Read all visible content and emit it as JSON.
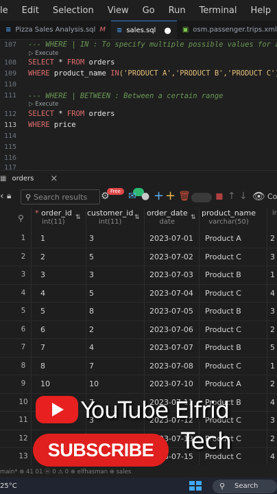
{
  "menubar": {
    "items": [
      "le",
      "Edit",
      "Selection",
      "View",
      "Go",
      "Run",
      "Terminal",
      "Help"
    ]
  },
  "tabs": [
    {
      "label": "Pizza Sales Analysis.sql",
      "modified": "M",
      "icon": "database-icon"
    },
    {
      "label": "sales.sql",
      "unsaved_dot": "●",
      "icon": "database-icon"
    },
    {
      "label": "osm.passenger.trips.xml",
      "icon": "xml-file-icon"
    }
  ],
  "editor": {
    "lines": [
      {
        "num": "107",
        "text": "--- WHERE | IN : To specify multiple possible values for a"
      },
      {
        "lens": "Execute"
      },
      {
        "num": "108",
        "kw1": "SELECT",
        "rest1": " * ",
        "kw2": "FROM",
        "rest2": " orders"
      },
      {
        "num": "109",
        "kw1": "WHERE",
        "rest1": " product_name ",
        "kw2": "IN",
        "str": "('PRODUCT A','PRODUCT B','PRODUCT C');"
      },
      {
        "num": "110"
      },
      {
        "num": "111"
      },
      {
        "num": "111",
        "text": "--- WHERE | BETWEEN : Between a certain range"
      },
      {
        "lens": "Execute"
      },
      {
        "num": "112",
        "kw1": "SELECT",
        "rest1": " * ",
        "kw2": "FROM",
        "rest2": " orders"
      },
      {
        "num": "113",
        "kw1": "WHERE",
        "rest1": " price"
      },
      {
        "num": "114"
      },
      {
        "num": "115"
      },
      {
        "num": "116"
      },
      {
        "num": "117"
      }
    ]
  },
  "panel": {
    "tab_label": "orders",
    "close": "×"
  },
  "toolbar": {
    "search_placeholder": "Search results",
    "badge": "Free",
    "co_label": "Co"
  },
  "grid": {
    "columns": [
      {
        "name": "order_id",
        "type": "int(11)",
        "required": "*"
      },
      {
        "name": "customer_id",
        "type": "int(11)"
      },
      {
        "name": "order_date",
        "type": "date"
      },
      {
        "name": "product_name",
        "type": "varchar(50)"
      },
      {
        "name": "",
        "type": "ir"
      }
    ],
    "rows": [
      [
        "1",
        "1",
        "3",
        "2023-07-01",
        "Product A",
        "2"
      ],
      [
        "2",
        "2",
        "5",
        "2023-07-02",
        "Product C",
        "3"
      ],
      [
        "3",
        "3",
        "3",
        "2023-07-03",
        "Product B",
        "1"
      ],
      [
        "4",
        "4",
        "5",
        "2023-07-04",
        "Product C",
        "4"
      ],
      [
        "5",
        "5",
        "8",
        "2023-07-05",
        "Product B",
        "3"
      ],
      [
        "6",
        "6",
        "2",
        "2023-07-06",
        "Product C",
        "2"
      ],
      [
        "7",
        "7",
        "4",
        "2023-07-07",
        "Product B",
        "5"
      ],
      [
        "8",
        "8",
        "7",
        "2023-07-08",
        "Product C",
        "1"
      ],
      [
        "9",
        "10",
        "10",
        "2023-07-10",
        "Product A",
        "2"
      ],
      [
        "10",
        "11",
        "7",
        "2023-07-11",
        "Product B",
        "4"
      ],
      [
        "11",
        "12",
        "3",
        "2023-07-12",
        "Product C",
        "3"
      ],
      [
        "12",
        "",
        "",
        "2023-07-13",
        "Product C",
        "2"
      ],
      [
        "13",
        "",
        "",
        "2023-07-15",
        "Product C",
        "4"
      ]
    ]
  },
  "statusbar": {
    "text": "main*  ⊗ 41 01   ⓦ 0 ⚠ 0   ⊕ elfhasman  ⊕ sales"
  },
  "taskbar": {
    "temperature": "25°C",
    "search_label": "Search"
  },
  "overlay": {
    "youtube": "YouTube",
    "name1": "Elfrid",
    "subscribe": "SUBSCRIBE",
    "name2": "Tech"
  },
  "colors": {
    "accent": "#3a7bd5",
    "youtube_red": "#e82020",
    "keyword": "#e06c6c",
    "string": "#e5c07b",
    "comment": "#6a9955"
  }
}
